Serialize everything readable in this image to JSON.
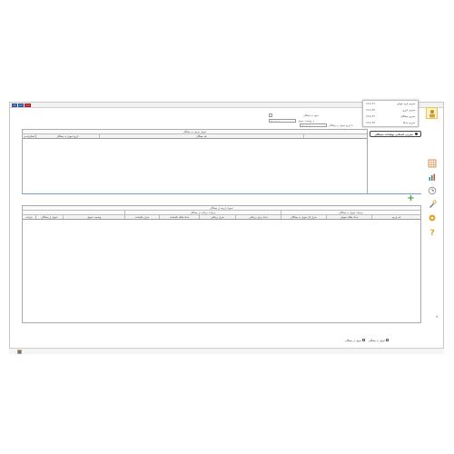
{
  "menu": {
    "items": [
      {
        "label": "مغربی بازیه موبای",
        "shortcut": "Ctrl+F1"
      },
      {
        "label": "مغربی انرژی",
        "shortcut": "Ctrl+F6"
      },
      {
        "label": "مغربی بیشگان",
        "shortcut": "Ctrl+F3"
      },
      {
        "label": "مغربی خذفا",
        "shortcut": "Ctrl+F8"
      }
    ]
  },
  "tooltip": {
    "text": "مغربی انتخابی تولیدات بیشگان"
  },
  "filters": {
    "from_label": "از وضعیت تحویل",
    "to_label": "تا تاریخ تحویل بر بیشگان",
    "status_label": "نحوه به بیشگان",
    "date_from": "۱۴۰۰/۰۰/۰۰",
    "date_to": "۱۴۰۰/۰۰/۰۰"
  },
  "table1": {
    "caption": "تحویل بازیچه به بیشگان",
    "columns": [
      "اصلاح/حذف",
      "تاریخ تحویل به بیشگان",
      "نام بیشگان",
      ""
    ]
  },
  "table2": {
    "caption": "تحویل بازیچه از بیشگان",
    "groups": [
      "",
      "جزئیات دریافت از بیشگان",
      "جزئیات تحویل به بیشگان"
    ],
    "columns": [
      "جزئیات",
      "تحویل از بیشگان",
      "وضعیت تحویل",
      "متراژ باقیمانده",
      "تعداد طاقه باقیمانده",
      "متراژ دریافتی",
      "تعداد برش دریافتی",
      "متراژ کل تحویل به بیشگان",
      "تعداد طاقه تحویلی",
      "نام پارچه"
    ]
  },
  "bottom_filters": [
    {
      "label": "تحویل از بیشگان"
    },
    {
      "label": "تحویل به بیشگان"
    }
  ],
  "sidebar": {
    "icons": [
      "user-icon",
      "calendar-grid-icon",
      "chart-icon",
      "clock-icon",
      "tools-icon",
      "gear-icon",
      "help-icon"
    ]
  }
}
